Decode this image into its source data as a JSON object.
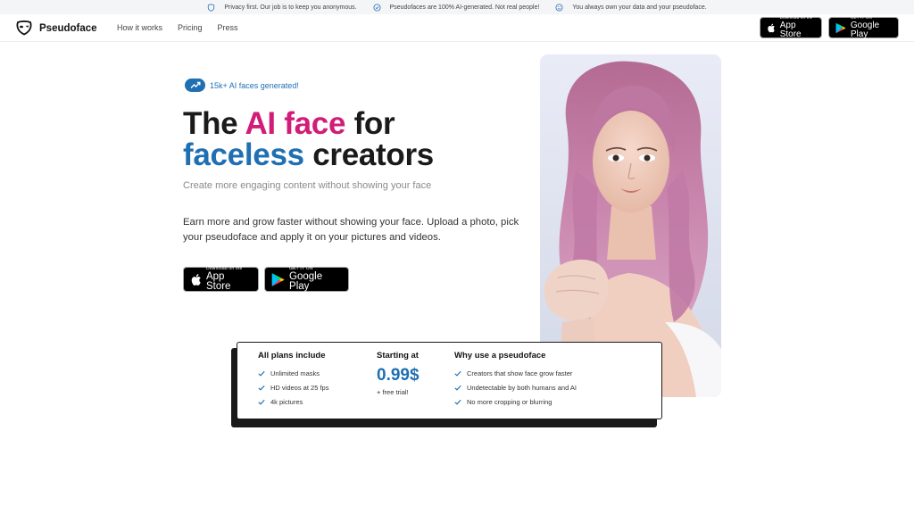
{
  "infobar": {
    "items": [
      {
        "icon": "shield-icon",
        "text": "Privacy first. Our job is to keep you anonymous."
      },
      {
        "icon": "badge-check-icon",
        "text": "Pseudofaces are 100% AI-generated. Not real people!"
      },
      {
        "icon": "smile-icon",
        "text": "You always own your data and your pseudoface."
      }
    ]
  },
  "header": {
    "brand": "Pseudoface",
    "nav": [
      "How it works",
      "Pricing",
      "Press"
    ],
    "app_store": {
      "small": "Download on the",
      "big": "App Store"
    },
    "google_play": {
      "small": "GET IT ON",
      "big": "Google Play"
    }
  },
  "hero": {
    "badge": "15k+ AI faces generated!",
    "title_part1": "The ",
    "title_highlight1": "AI face",
    "title_part2": " for",
    "title_highlight2": "faceless",
    "title_part3": " creators",
    "subtitle": "Create more engaging content without showing your face",
    "description": "Earn more and grow faster without showing your face. Upload a photo, pick your pseudoface and apply it on your pictures and videos.",
    "app_store": {
      "small": "Download on the",
      "big": "App Store"
    },
    "google_play": {
      "small": "GET IT ON",
      "big": "Google Play"
    }
  },
  "plans": {
    "col1_title": "All plans include",
    "col1_items": [
      "Unlimited masks",
      "HD videos at 25 fps",
      "4k pictures"
    ],
    "col2_title": "Starting at",
    "price": "0.99$",
    "trial": "+ free trial!",
    "col3_title": "Why use a pseudoface",
    "col3_items": [
      "Creators that show face grow faster",
      "Undetectable by both humans and AI",
      "No more cropping or blurring"
    ]
  },
  "colors": {
    "accent_pink": "#d11c78",
    "accent_blue": "#1f6fb3",
    "text_dark": "#1a1a1a"
  }
}
